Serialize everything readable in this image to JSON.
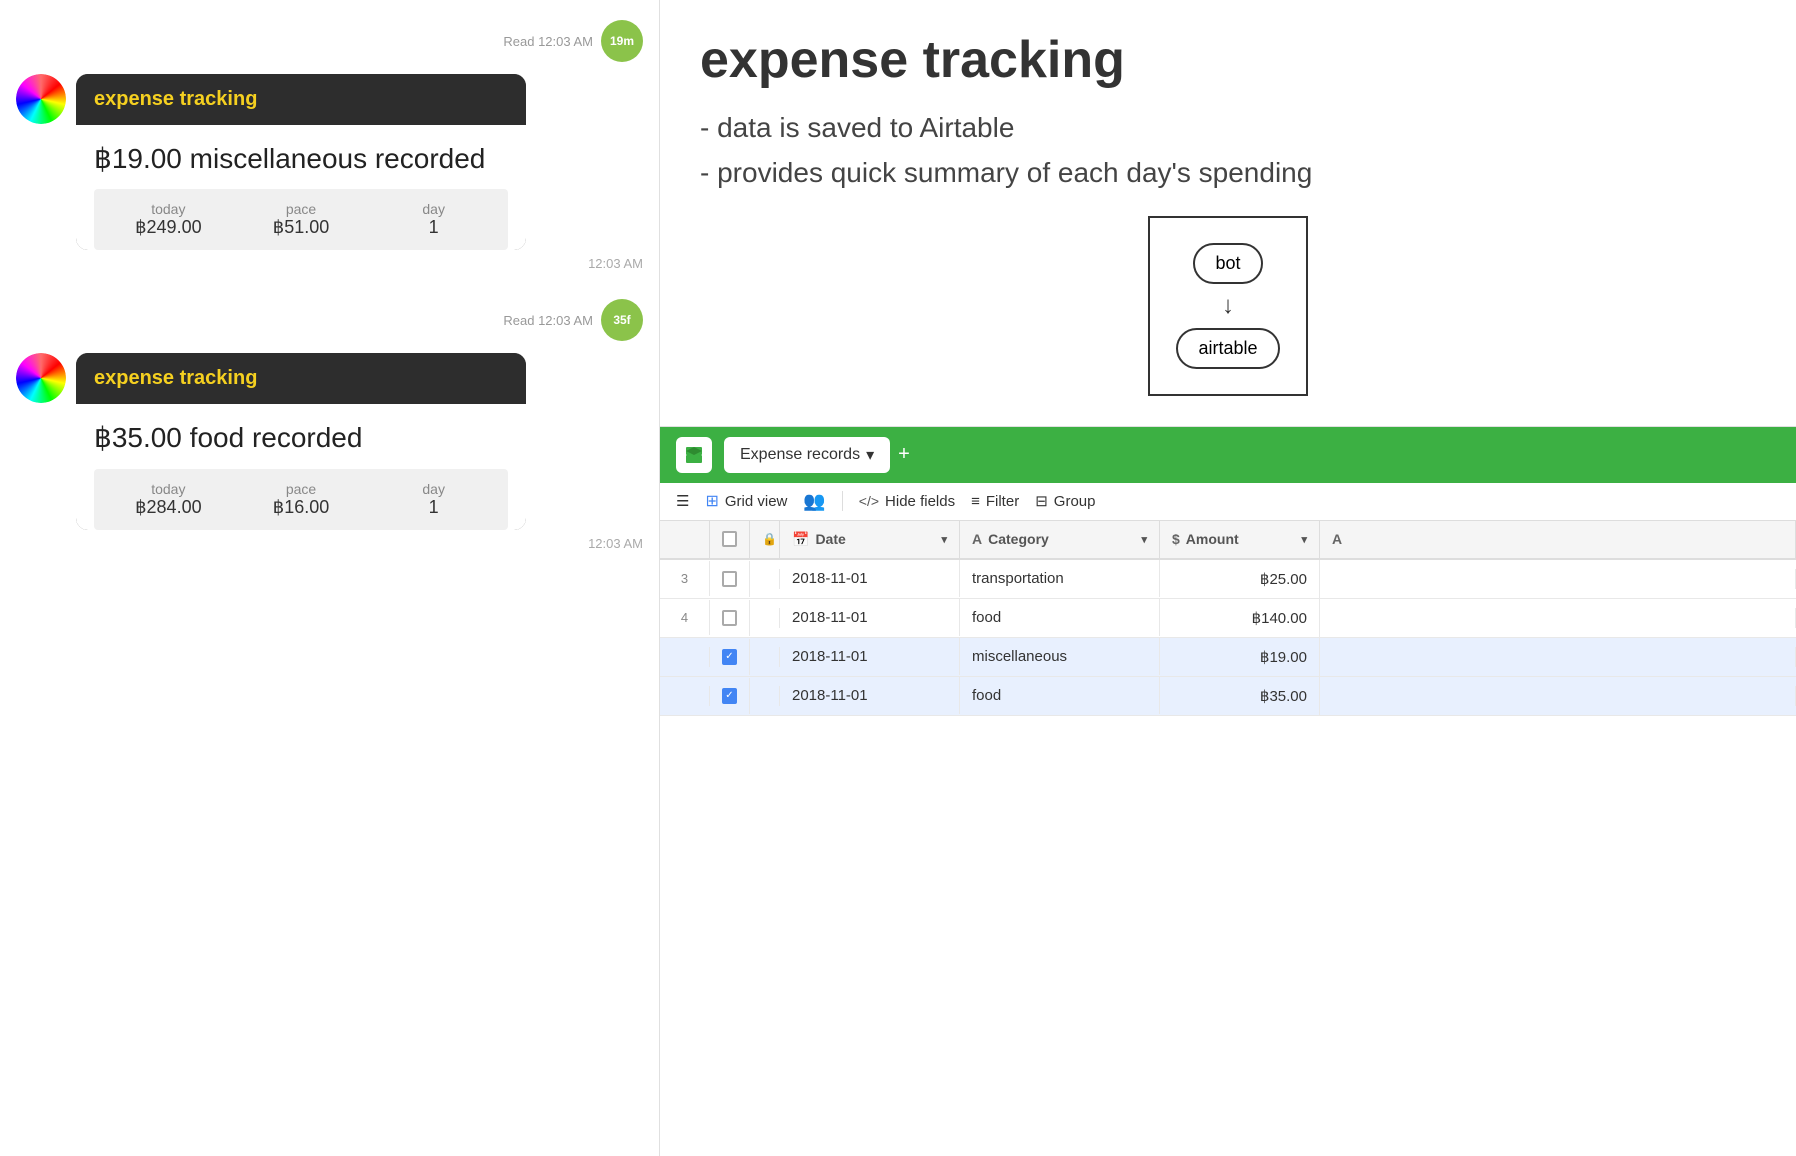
{
  "chat": {
    "message1": {
      "read_text": "Read\n12:03 AM",
      "time_badge": "19m",
      "card_title": "expense tracking",
      "amount_text": "฿19.00 miscellaneous recorded",
      "stats": {
        "today_label": "today",
        "today_value": "฿249.00",
        "pace_label": "pace",
        "pace_value": "฿51.00",
        "day_label": "day",
        "day_value": "1"
      },
      "timestamp": "12:03 AM"
    },
    "message2": {
      "read_text": "Read\n12:03 AM",
      "time_badge": "35f",
      "card_title": "expense tracking",
      "amount_text": "฿35.00 food recorded",
      "stats": {
        "today_label": "today",
        "today_value": "฿284.00",
        "pace_label": "pace",
        "pace_value": "฿16.00",
        "day_label": "day",
        "day_value": "1"
      },
      "timestamp": "12:03 AM"
    }
  },
  "description": {
    "title": "expense tracking",
    "points": [
      "data is saved to Airtable",
      "provides quick summary of each day's spending"
    ],
    "diagram": {
      "node1": "bot",
      "node2": "airtable"
    }
  },
  "airtable": {
    "logo_icon": "box-icon",
    "tab_name": "Expense records",
    "add_icon": "+",
    "toolbar": {
      "menu_icon": "☰",
      "view_icon": "⊞",
      "view_label": "Grid view",
      "people_icon": "👥",
      "hide_icon": "</>",
      "hide_label": "Hide fields",
      "filter_icon": "≡",
      "filter_label": "Filter",
      "group_icon": "⊟",
      "group_label": "Group"
    },
    "columns": [
      {
        "label": "Date",
        "icon": "📅"
      },
      {
        "label": "Category",
        "icon": "A"
      },
      {
        "label": "Amount",
        "icon": "$"
      },
      {
        "label": "A",
        "icon": "A"
      }
    ],
    "rows": [
      {
        "num": "3",
        "checked": false,
        "date": "2018-11-01",
        "category": "transportation",
        "amount": "฿25.00",
        "selected": false
      },
      {
        "num": "4",
        "checked": false,
        "date": "2018-11-01",
        "category": "food",
        "amount": "฿140.00",
        "selected": false
      },
      {
        "num": "",
        "checked": true,
        "date": "2018-11-01",
        "category": "miscellaneous",
        "amount": "฿19.00",
        "selected": true
      },
      {
        "num": "",
        "checked": true,
        "date": "2018-11-01",
        "category": "food",
        "amount": "฿35.00",
        "selected": true
      }
    ]
  }
}
